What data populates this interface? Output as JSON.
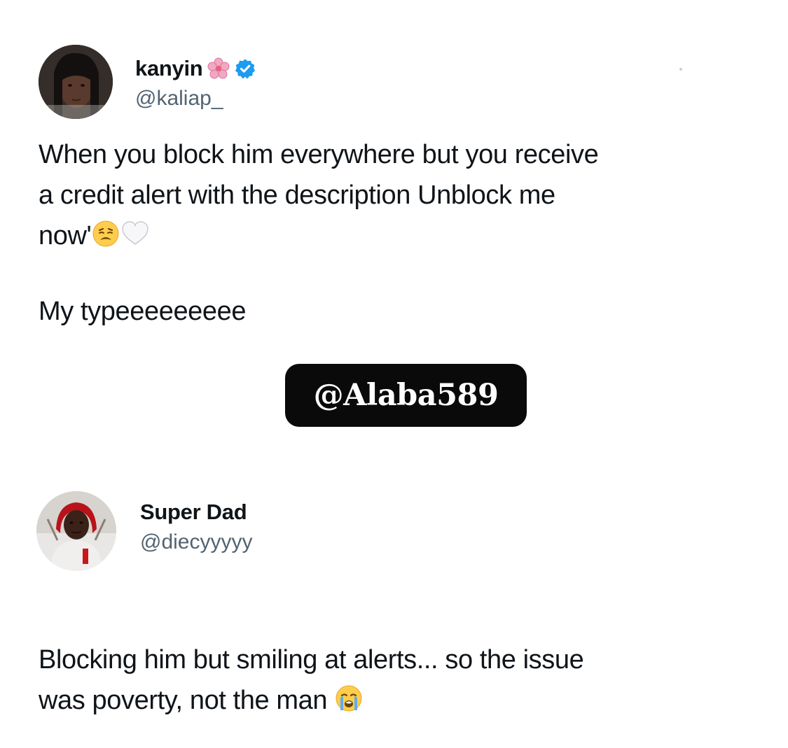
{
  "tweets": [
    {
      "author": {
        "display_name": "kanyin",
        "name_emoji": "flower-icon",
        "verified": true,
        "handle": "@kaliap_"
      },
      "text_lines": [
        "When you block him everywhere but you receive",
        "a credit alert with the description Unblock me",
        "now'"
      ],
      "text_emojis": [
        "weary-face-icon",
        "white-heart-icon"
      ],
      "text_2": "My typeeeeeeeee"
    },
    {
      "author": {
        "display_name": "Super Dad",
        "verified": false,
        "handle": "@diecyyyyy"
      },
      "text_lines": [
        "Blocking him but smiling at alerts... so the issue",
        "was poverty, not the man"
      ],
      "text_emojis": [
        "loudly-crying-face-icon"
      ]
    }
  ],
  "watermark": {
    "text": "@Alaba589"
  },
  "colors": {
    "background": "#ffffff",
    "text": "#0f1419",
    "handle": "#536471",
    "verified": "#1d9bf0",
    "watermark_bg": "#0a0a0a",
    "watermark_text": "#ffffff"
  }
}
